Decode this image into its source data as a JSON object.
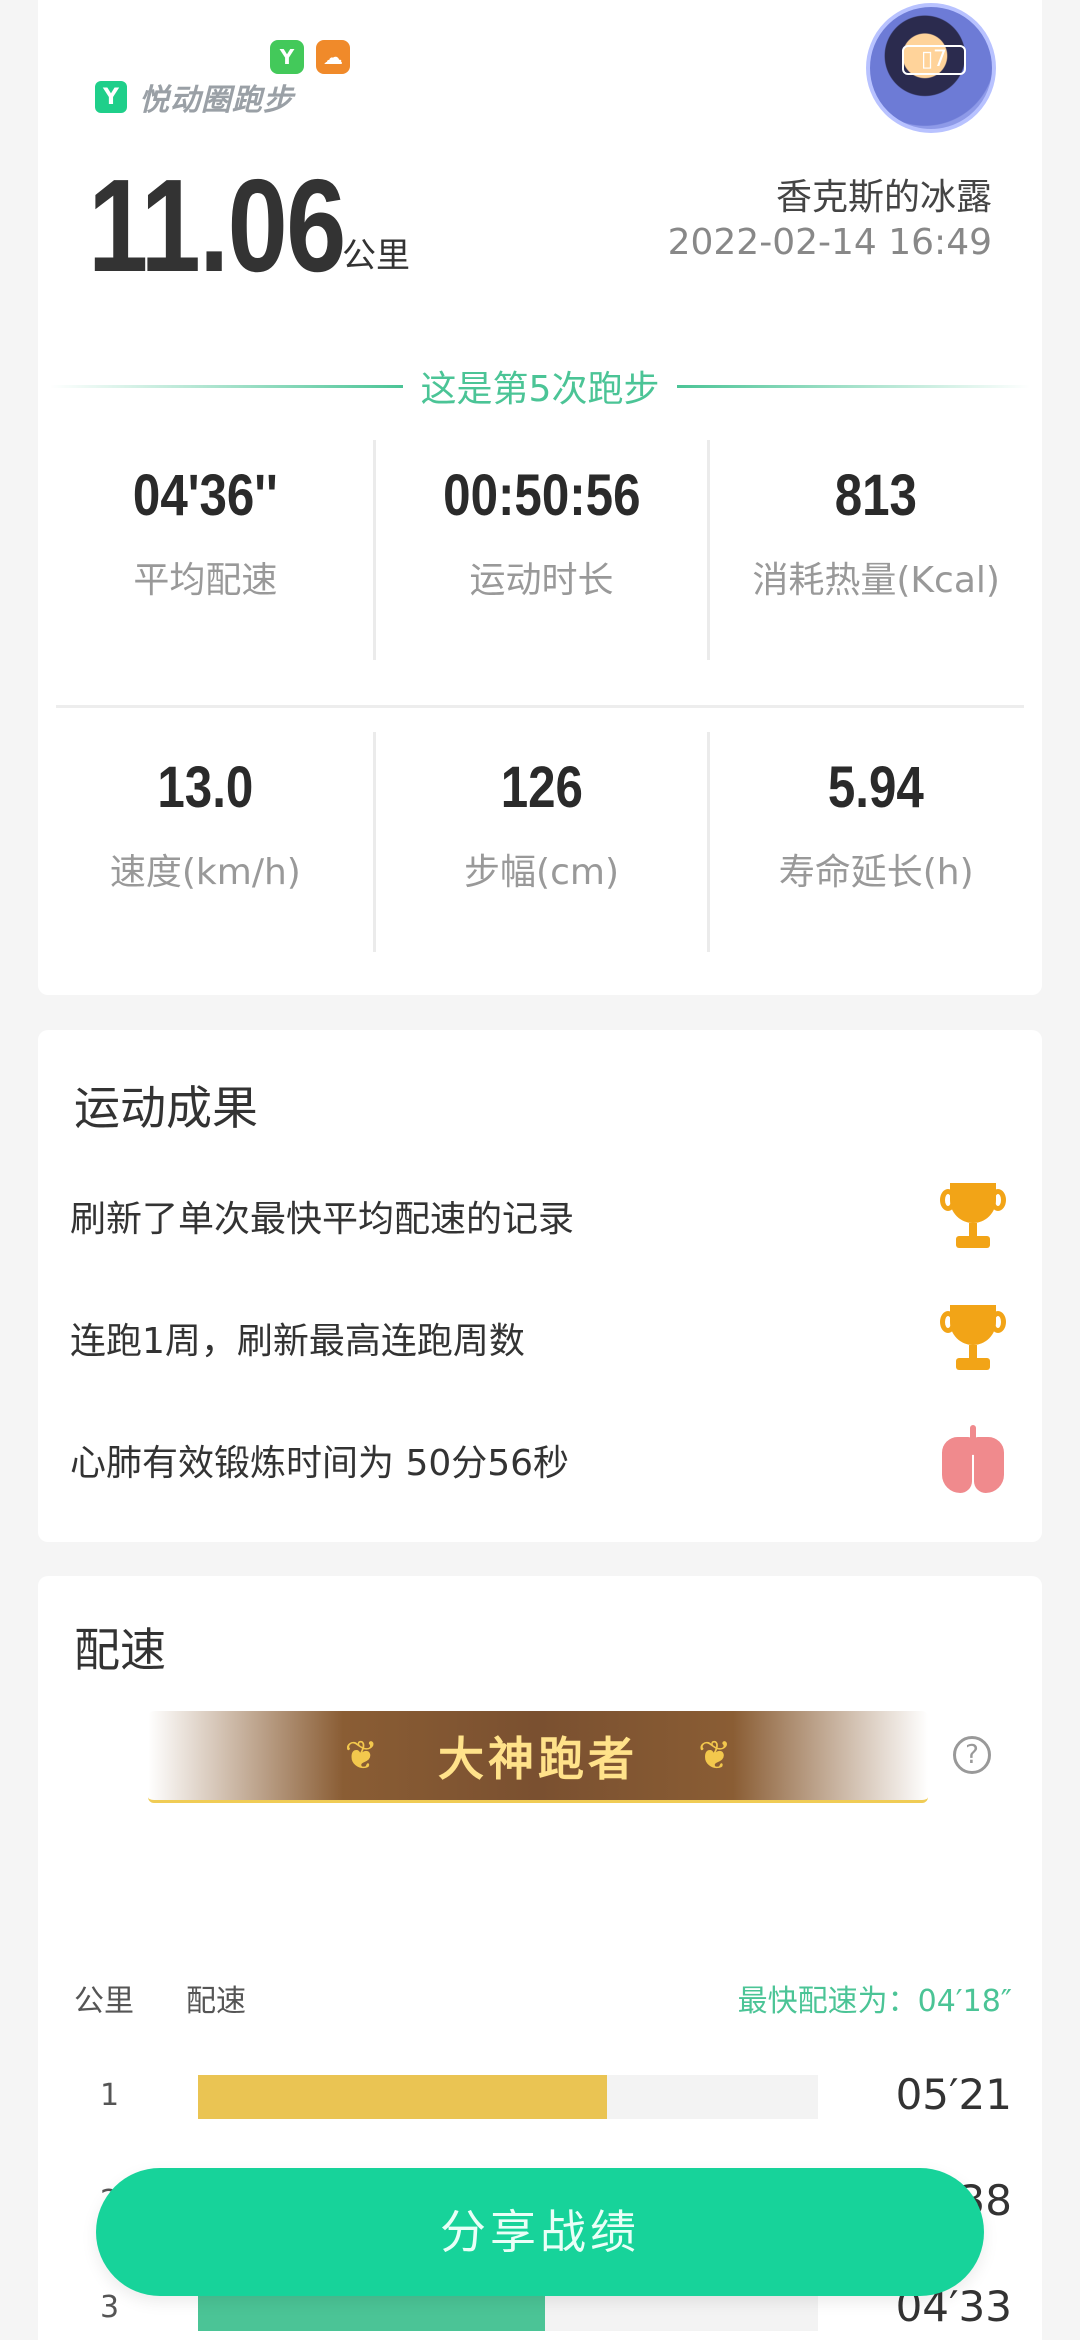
{
  "header": {
    "app_name": "悦动圈跑步",
    "logo_glyph": "Y",
    "mini_icons": [
      {
        "name": "yuedong-icon",
        "glyph": "Y",
        "color": "#43c95a"
      },
      {
        "name": "uc-browser-icon",
        "glyph": "☁",
        "color": "#f08a2a"
      }
    ],
    "avatar_badge": "▯7",
    "distance_value": "11.06",
    "distance_unit": "公里",
    "user_name": "香克斯的冰露",
    "datetime": "2022-02-14 16:49",
    "run_count_text": "这是第5次跑步"
  },
  "stats_row1": [
    {
      "value": "04'36''",
      "label": "平均配速"
    },
    {
      "value": "00:50:56",
      "label": "运动时长"
    },
    {
      "value": "813",
      "label": "消耗热量(Kcal)"
    }
  ],
  "stats_row2": [
    {
      "value": "13.0",
      "label": "速度(km/h)"
    },
    {
      "value": "126",
      "label": "步幅(cm)"
    },
    {
      "value": "5.94",
      "label": "寿命延长(h)"
    }
  ],
  "achievements": {
    "title": "运动成果",
    "items": [
      {
        "text": "刷新了单次最快平均配速的记录",
        "icon": "trophy-icon"
      },
      {
        "text": "连跑1周，刷新最高连跑周数",
        "icon": "trophy-icon"
      },
      {
        "text": "心肺有效锻炼时间为 50分56秒",
        "icon": "lungs-icon"
      }
    ]
  },
  "pace": {
    "title": "配速",
    "banner_text": "大神跑者",
    "help_glyph": "?",
    "col_km": "公里",
    "col_pace": "配速",
    "best_text": "最快配速为：04′18″",
    "rows": [
      {
        "km": "1",
        "value": "05′21",
        "fraction": 0.66,
        "color": "#eac453"
      },
      {
        "km": "2",
        "value": "04′38",
        "fraction": 0.72,
        "color": "#8fd6bb"
      },
      {
        "km": "3",
        "value": "04′33",
        "fraction": 0.56,
        "color": "#4bc496"
      }
    ]
  },
  "share_button": "分享战绩"
}
